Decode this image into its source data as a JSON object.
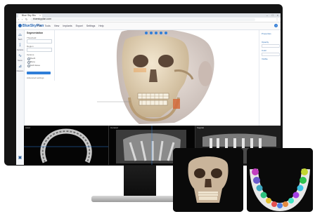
{
  "browser": {
    "tab_label": "Blue Sky Bio",
    "url": "blueskyplan.com",
    "minimize": "–",
    "maximize": "□",
    "close": "×"
  },
  "app": {
    "logo": "BlueSkyPlan",
    "menu": [
      "File",
      "Tools",
      "View",
      "Implants",
      "Export",
      "Settings",
      "Help"
    ],
    "help": "?"
  },
  "toolbar": {
    "items": [
      {
        "icon": "tooth-icon",
        "label": "Teeth"
      },
      {
        "icon": "implant-icon",
        "label": "Implants"
      },
      {
        "icon": "nerve-icon",
        "label": "Nerve"
      },
      {
        "icon": "ruler-icon",
        "label": "Measure"
      },
      {
        "icon": "export-icon",
        "label": "Export"
      }
    ]
  },
  "panel": {
    "title": "Segmentation",
    "field1_label": "Threshold",
    "field2_label": "Region",
    "options_label": "Options",
    "options": [
      "Teeth",
      "Bone",
      "Soft tissue"
    ],
    "button_label": "Apply",
    "footer_label": "Advanced settings"
  },
  "right_panel": {
    "labels": [
      "Properties",
      "Opacity",
      "Color",
      "Visible"
    ]
  },
  "slices": {
    "labels": [
      "Axial",
      "Coronal",
      "Sagittal"
    ]
  },
  "colors": {
    "accent": "#2f7ed8",
    "bone": "#e9dcc4",
    "skin": "#d7c8c0"
  }
}
